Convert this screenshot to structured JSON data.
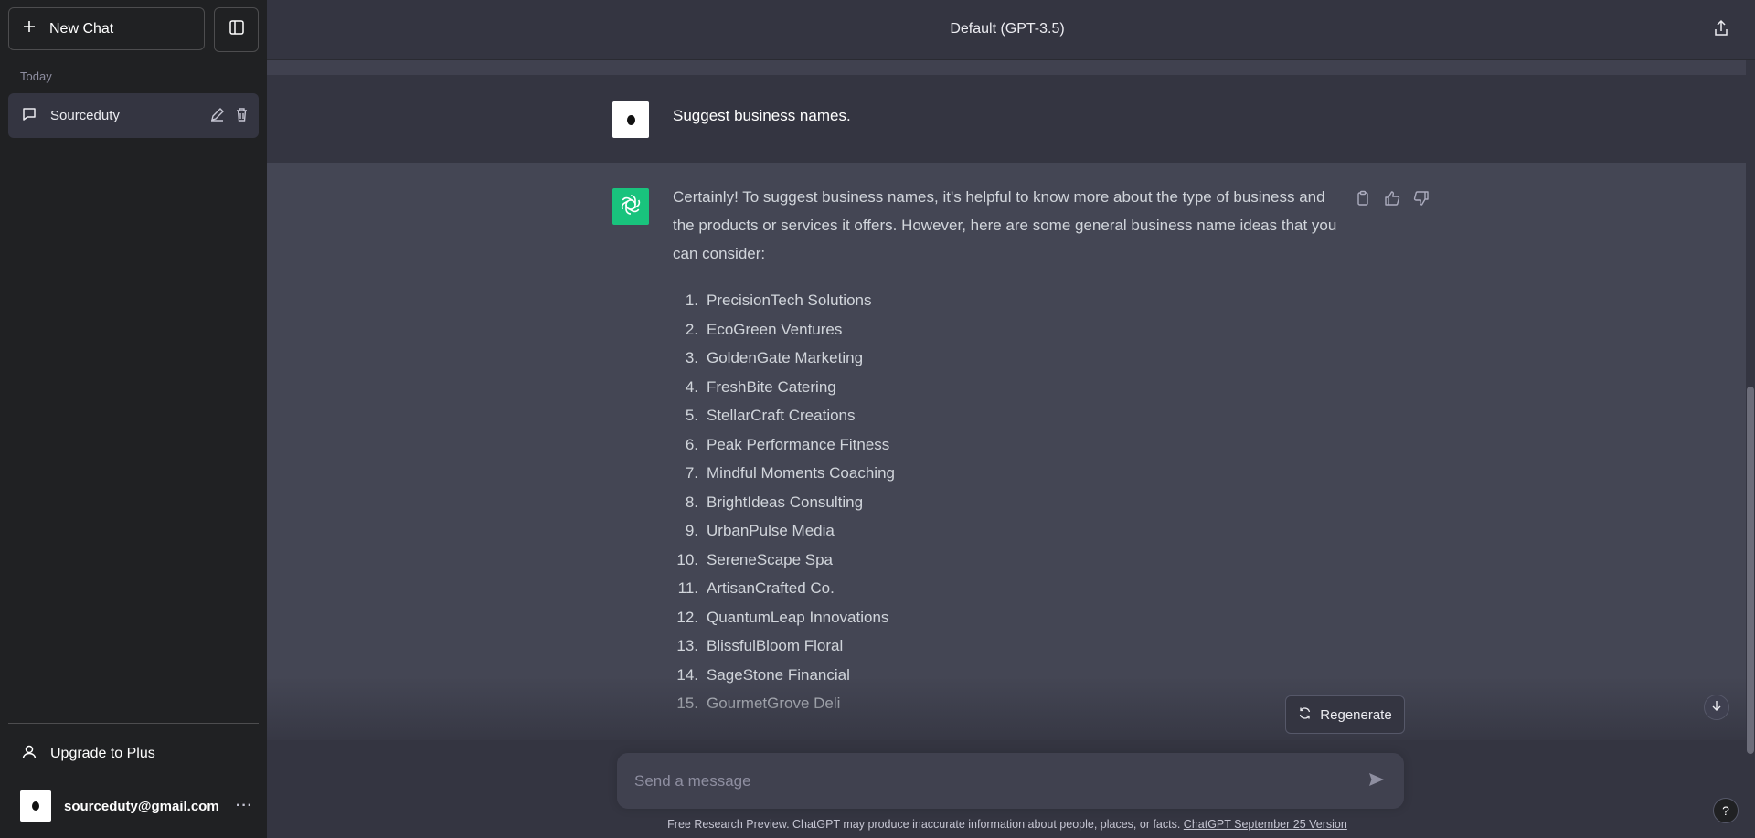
{
  "sidebar": {
    "new_chat_label": "New Chat",
    "section_label": "Today",
    "chats": [
      {
        "title": "Sourceduty"
      }
    ],
    "upgrade_label": "Upgrade to Plus",
    "account_email": "sourceduty@gmail.com",
    "more_label": "···"
  },
  "header": {
    "model_label": "Default (GPT-3.5)"
  },
  "conversation": {
    "user_message": "Suggest business names.",
    "assistant_intro": "Certainly! To suggest business names, it's helpful to know more about the type of business and the products or services it offers. However, here are some general business name ideas that you can consider:",
    "assistant_list": [
      {
        "n": "1.",
        "text": "PrecisionTech Solutions"
      },
      {
        "n": "2.",
        "text": "EcoGreen Ventures"
      },
      {
        "n": "3.",
        "text": "GoldenGate Marketing"
      },
      {
        "n": "4.",
        "text": "FreshBite Catering"
      },
      {
        "n": "5.",
        "text": "StellarCraft Creations"
      },
      {
        "n": "6.",
        "text": "Peak Performance Fitness"
      },
      {
        "n": "7.",
        "text": "Mindful Moments Coaching"
      },
      {
        "n": "8.",
        "text": "BrightIdeas Consulting"
      },
      {
        "n": "9.",
        "text": "UrbanPulse Media"
      },
      {
        "n": "10.",
        "text": "SereneScape Spa"
      },
      {
        "n": "11.",
        "text": "ArtisanCrafted Co."
      },
      {
        "n": "12.",
        "text": "QuantumLeap Innovations"
      },
      {
        "n": "13.",
        "text": "BlissfulBloom Floral"
      },
      {
        "n": "14.",
        "text": "SageStone Financial"
      },
      {
        "n": "15.",
        "text": "GourmetGrove Deli"
      }
    ]
  },
  "composer": {
    "regenerate_label": "Regenerate",
    "placeholder": "Send a message"
  },
  "footer": {
    "text": "Free Research Preview. ChatGPT may produce inaccurate information about people, places, or facts. ",
    "link": "ChatGPT September 25 Version"
  },
  "help_label": "?",
  "colors": {
    "sidebar_bg": "#202123",
    "main_bg": "#343541",
    "assistant_bg": "#444654",
    "assistant_avatar": "#19c37d",
    "input_bg": "#40414f"
  },
  "icons": [
    "plus-icon",
    "sidebar-toggle-icon",
    "chat-bubble-icon",
    "edit-icon",
    "trash-icon",
    "user-icon",
    "share-icon",
    "openai-logo-icon",
    "clipboard-icon",
    "thumbs-up-icon",
    "thumbs-down-icon",
    "refresh-icon",
    "send-icon",
    "arrow-down-icon"
  ]
}
